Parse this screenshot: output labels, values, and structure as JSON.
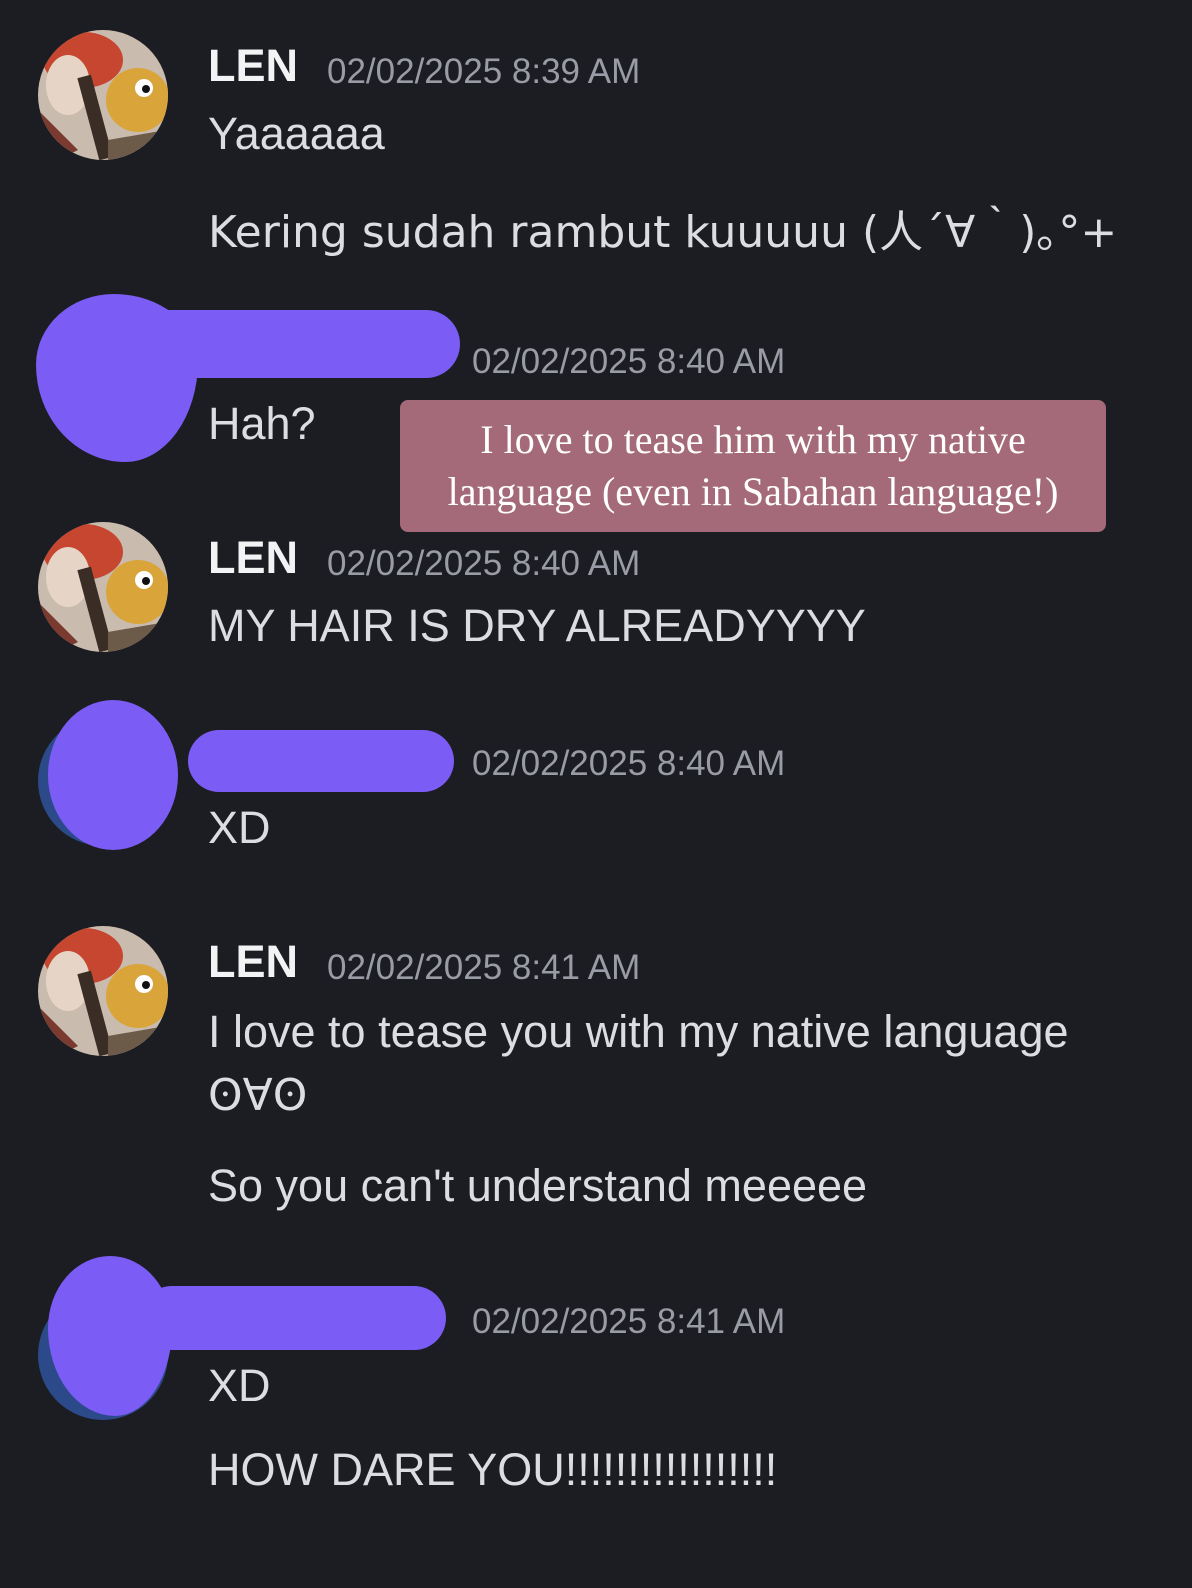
{
  "messages": [
    {
      "username": "LEN",
      "timestamp": "02/02/2025 8:39 AM",
      "lines": [
        "Yaaaaaa",
        "Kering sudah rambut kuuuuu (人´∀｀)｡°+"
      ]
    },
    {
      "username": "",
      "timestamp": "02/02/2025 8:40 AM",
      "lines": [
        "Hah?"
      ]
    },
    {
      "username": "LEN",
      "timestamp": "02/02/2025 8:40 AM",
      "lines": [
        "MY HAIR IS DRY ALREADYYYY"
      ]
    },
    {
      "username": "",
      "timestamp": "02/02/2025 8:40 AM",
      "lines": [
        "XD"
      ]
    },
    {
      "username": "LEN",
      "timestamp": "02/02/2025 8:41 AM",
      "lines": [
        "I love to tease you with my native language",
        "ʘ∀ʘ",
        "So you can't understand meeeee"
      ]
    },
    {
      "username": "",
      "timestamp": "02/02/2025 8:41 AM",
      "lines": [
        "XD",
        "HOW DARE YOU!!!!!!!!!!!!!!!!!"
      ]
    }
  ],
  "annotation": {
    "text": "I love to tease him with my native language (even in Sabahan language!)"
  },
  "colors": {
    "background": "#1c1d22",
    "redaction": "#7b5cf5",
    "annotation": "#a56a7a",
    "timestamp": "#9a9ca5"
  }
}
